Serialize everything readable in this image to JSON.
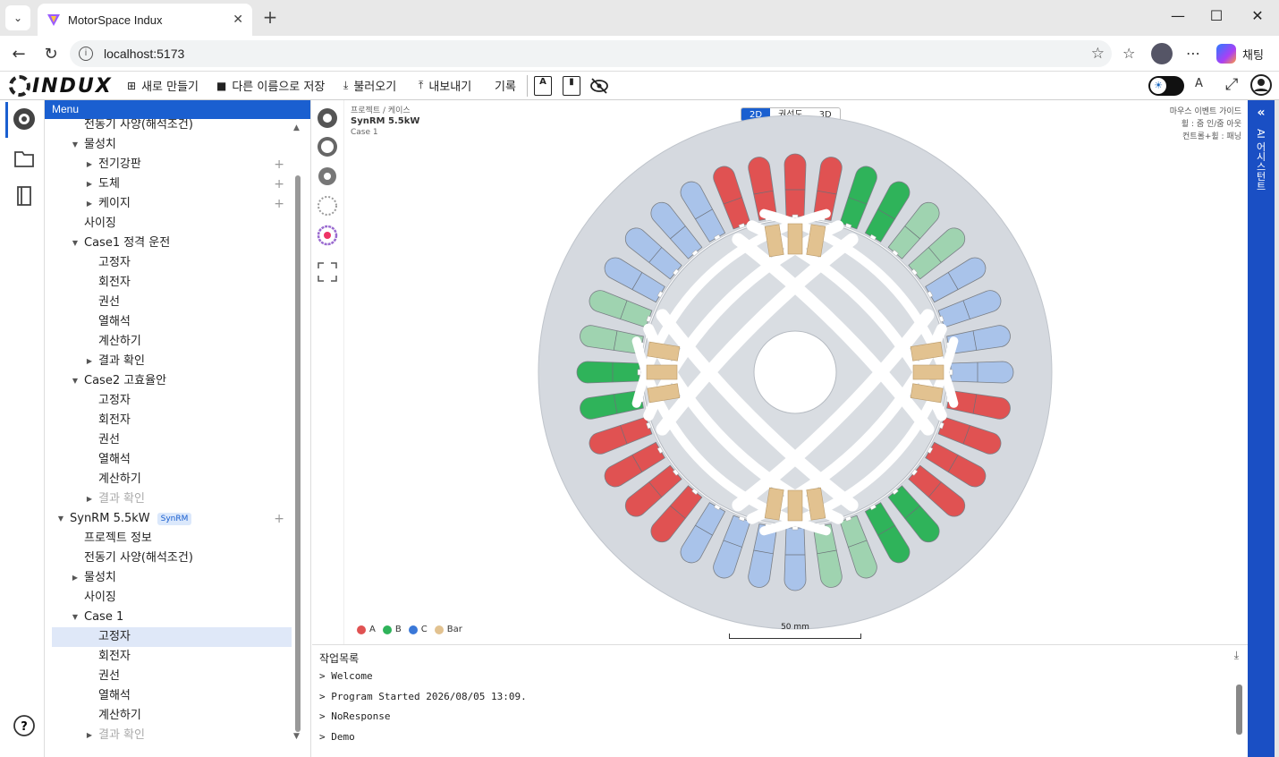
{
  "browser": {
    "tab_title": "MotorSpace Indux",
    "url": "localhost:5173",
    "chat_label": "채팅"
  },
  "toolbar": {
    "logo": "INDUX",
    "new": "새로 만들기",
    "save_as": "다른 이름으로 저장",
    "load": "불러오기",
    "export": "내보내기",
    "record": "기록"
  },
  "tree": {
    "header": "Menu",
    "nodes": [
      {
        "label": "전동기 사양(해석조건)",
        "indent": 44,
        "caret": "",
        "plus": false
      },
      {
        "label": "물성치",
        "indent": 44,
        "caret": "▼",
        "plus": false
      },
      {
        "label": "전기강판",
        "indent": 60,
        "caret": "▶",
        "plus": true
      },
      {
        "label": "도체",
        "indent": 60,
        "caret": "▶",
        "plus": true
      },
      {
        "label": "케이지",
        "indent": 60,
        "caret": "▶",
        "plus": true
      },
      {
        "label": "사이징",
        "indent": 44,
        "caret": "",
        "plus": false
      },
      {
        "label": "Case1 정격 운전",
        "indent": 44,
        "caret": "▼",
        "plus": false
      },
      {
        "label": "고정자",
        "indent": 60,
        "caret": "",
        "plus": false
      },
      {
        "label": "회전자",
        "indent": 60,
        "caret": "",
        "plus": false
      },
      {
        "label": "권선",
        "indent": 60,
        "caret": "",
        "plus": false
      },
      {
        "label": "열해석",
        "indent": 60,
        "caret": "",
        "plus": false
      },
      {
        "label": "계산하기",
        "indent": 60,
        "caret": "",
        "plus": false
      },
      {
        "label": "결과 확인",
        "indent": 60,
        "caret": "▶",
        "plus": false
      },
      {
        "label": "Case2 고효율안",
        "indent": 44,
        "caret": "▼",
        "plus": false
      },
      {
        "label": "고정자",
        "indent": 60,
        "caret": "",
        "plus": false
      },
      {
        "label": "회전자",
        "indent": 60,
        "caret": "",
        "plus": false
      },
      {
        "label": "권선",
        "indent": 60,
        "caret": "",
        "plus": false
      },
      {
        "label": "열해석",
        "indent": 60,
        "caret": "",
        "plus": false
      },
      {
        "label": "계산하기",
        "indent": 60,
        "caret": "",
        "plus": false
      },
      {
        "label": "결과 확인",
        "indent": 60,
        "caret": "▶",
        "plus": false,
        "muted": true
      },
      {
        "label": "SynRM 5.5kW",
        "indent": 28,
        "caret": "▼",
        "plus": true,
        "badge": "SynRM"
      },
      {
        "label": "프로젝트 정보",
        "indent": 44,
        "caret": "",
        "plus": false
      },
      {
        "label": "전동기 사양(해석조건)",
        "indent": 44,
        "caret": "",
        "plus": false
      },
      {
        "label": "물성치",
        "indent": 44,
        "caret": "▶",
        "plus": false
      },
      {
        "label": "사이징",
        "indent": 44,
        "caret": "",
        "plus": false
      },
      {
        "label": "Case 1",
        "indent": 44,
        "caret": "▼",
        "plus": false
      },
      {
        "label": "고정자",
        "indent": 60,
        "caret": "",
        "plus": false,
        "selected": true
      },
      {
        "label": "회전자",
        "indent": 60,
        "caret": "",
        "plus": false
      },
      {
        "label": "권선",
        "indent": 60,
        "caret": "",
        "plus": false
      },
      {
        "label": "열해석",
        "indent": 60,
        "caret": "",
        "plus": false
      },
      {
        "label": "계산하기",
        "indent": 60,
        "caret": "",
        "plus": false
      },
      {
        "label": "결과 확인",
        "indent": 60,
        "caret": "▶",
        "plus": false,
        "muted": true
      }
    ]
  },
  "canvas": {
    "breadcrumb": "프로젝트 / 케이스",
    "project": "SynRM 5.5kW",
    "case": "Case 1",
    "view_modes": [
      "2D",
      "권선도",
      "3D"
    ],
    "active_view": "2D",
    "mouse_guide_title": "마우스 이벤트 가이드",
    "mouse_guide_wheel": "휠 : 줌 인/줌 아웃",
    "mouse_guide_pan": "컨트롤+휠 : 패닝",
    "legend": [
      {
        "label": "A",
        "color": "#e05252"
      },
      {
        "label": "B",
        "color": "#2fb35a"
      },
      {
        "label": "C",
        "color": "#3a78d8"
      },
      {
        "label": "Bar",
        "color": "#e2c290"
      }
    ],
    "scale": "50 mm",
    "slots": 36
  },
  "log": {
    "title": "작업목록",
    "lines": [
      "> Welcome",
      "> Program Started 2026/08/05 13:09.",
      "> NoResponse",
      "> Demo"
    ]
  },
  "ai_panel": {
    "label": "AI 어시스턴트"
  }
}
